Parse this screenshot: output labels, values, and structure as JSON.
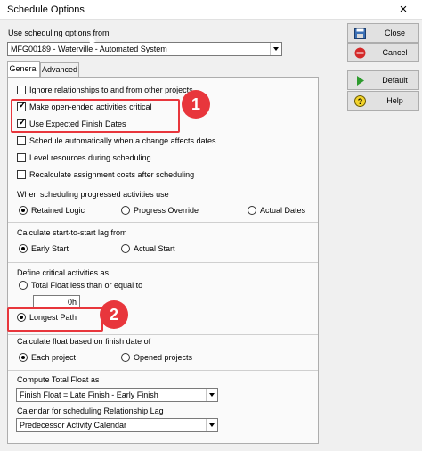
{
  "window": {
    "title": "Schedule Options",
    "close_glyph": "×"
  },
  "top": {
    "label": "Use scheduling options from",
    "source": "MFG00189 - Waterville - Automated System"
  },
  "tabs": [
    {
      "label": "General",
      "active": true
    },
    {
      "label": "Advanced",
      "active": false
    }
  ],
  "options": {
    "ignore_relationships": {
      "label": "Ignore relationships to and from other projects",
      "checked": false
    },
    "open_ended_critical": {
      "label": "Make open-ended activities critical",
      "checked": true
    },
    "expected_finish": {
      "label": "Use Expected Finish Dates",
      "checked": true
    },
    "auto_schedule": {
      "label": "Schedule automatically when a change affects dates",
      "checked": false
    },
    "level_resources": {
      "label": "Level resources during scheduling",
      "checked": false
    },
    "recalc_costs": {
      "label": "Recalculate assignment costs after scheduling",
      "checked": false
    }
  },
  "progressed": {
    "heading": "When scheduling progressed activities use",
    "options": [
      "Retained Logic",
      "Progress Override",
      "Actual Dates"
    ],
    "selected": "Retained Logic"
  },
  "lag": {
    "heading": "Calculate start-to-start lag from",
    "options": [
      "Early Start",
      "Actual Start"
    ],
    "selected": "Early Start"
  },
  "critical": {
    "heading": "Define critical activities as",
    "total_float_label": "Total Float less than or equal to",
    "total_float_value": "0h",
    "longest_path_label": "Longest Path",
    "selected": "Longest Path"
  },
  "float_basis": {
    "heading": "Calculate float based on finish date of",
    "options": [
      "Each project",
      "Opened projects"
    ],
    "selected": "Each project"
  },
  "total_float": {
    "heading": "Compute Total Float as",
    "value": "Finish Float = Late Finish - Early Finish"
  },
  "calendar": {
    "heading": "Calendar for scheduling Relationship Lag",
    "value": "Predecessor Activity Calendar"
  },
  "buttons": {
    "close": "Close",
    "cancel": "Cancel",
    "default": "Default",
    "help": "Help"
  },
  "callouts": {
    "one": "1",
    "two": "2"
  },
  "colors": {
    "callout": "#e8363c",
    "accent_green": "#2e9b2e",
    "cancel_red": "#d42a2a"
  },
  "icons": {
    "close_button": "save-disk-icon",
    "cancel_button": "cancel-circle-icon",
    "default_button": "play-arrow-icon",
    "help_button": "help-question-icon"
  }
}
